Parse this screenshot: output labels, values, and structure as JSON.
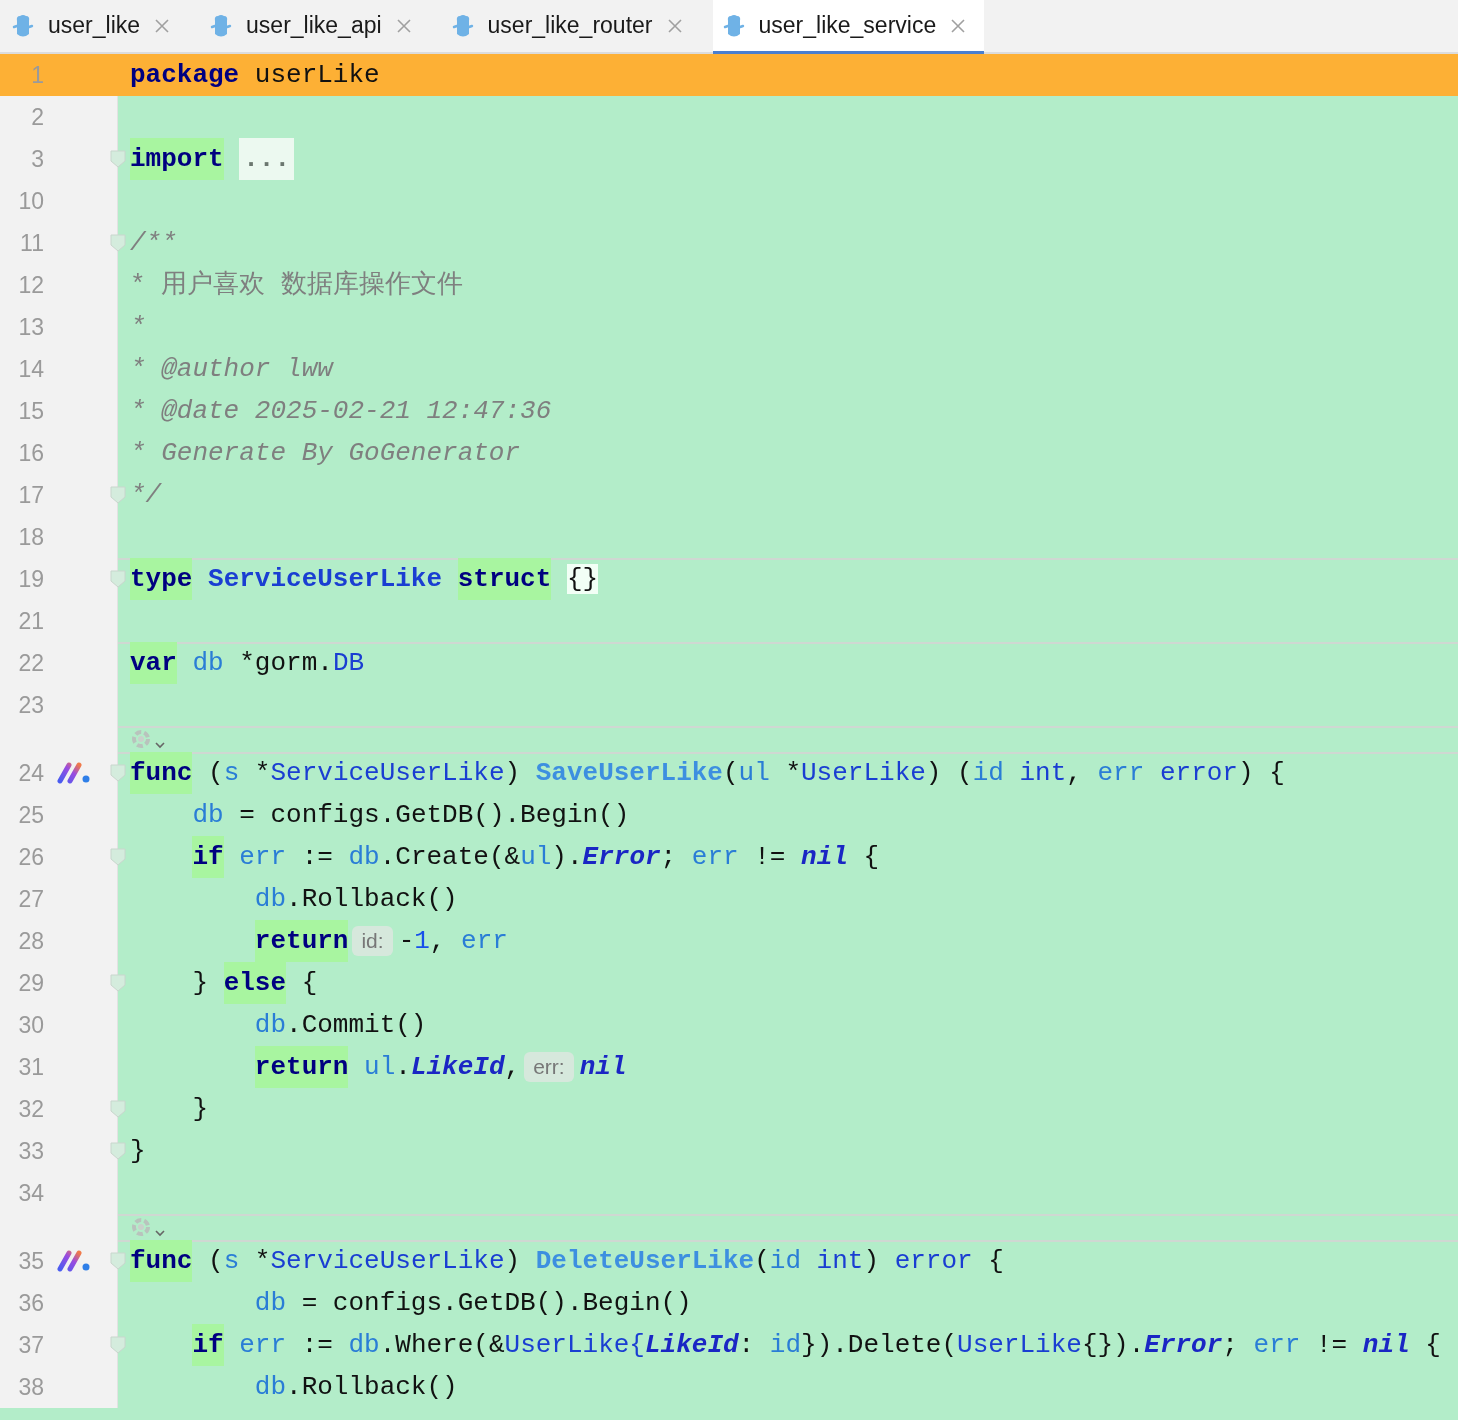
{
  "tabs": [
    {
      "label": "user_like",
      "selected": false
    },
    {
      "label": "user_like_api",
      "selected": false
    },
    {
      "label": "user_like_router",
      "selected": false
    },
    {
      "label": "user_like_service",
      "selected": true
    }
  ],
  "lines": [
    {
      "number": "1",
      "current": true,
      "fold": false,
      "implemented": false,
      "separator": false,
      "lens": false,
      "tokens": [
        {
          "kind": "kw_plain",
          "text": "package"
        },
        {
          "kind": "p",
          "text": " userLike"
        }
      ]
    },
    {
      "number": "2",
      "current": false,
      "fold": false,
      "implemented": false,
      "separator": false,
      "lens": false
    },
    {
      "number": "3",
      "current": false,
      "fold": true,
      "implemented": false,
      "separator": false,
      "lens": false,
      "tokens": [
        {
          "kind": "kw",
          "text": "import"
        },
        {
          "kind": "fold",
          "text": " ..."
        }
      ]
    },
    {
      "number": "10",
      "current": false,
      "fold": false,
      "implemented": false,
      "separator": false,
      "lens": false
    },
    {
      "number": "11",
      "current": false,
      "fold": true,
      "implemented": false,
      "separator": false,
      "lens": false,
      "tokens": [
        {
          "kind": "c",
          "text": "/**"
        }
      ]
    },
    {
      "number": "12",
      "current": false,
      "fold": false,
      "implemented": false,
      "separator": false,
      "lens": false,
      "tokens": [
        {
          "kind": "cz",
          "text": "* 用户喜欢 数据库操作文件"
        }
      ]
    },
    {
      "number": "13",
      "current": false,
      "fold": false,
      "implemented": false,
      "separator": false,
      "lens": false,
      "tokens": [
        {
          "kind": "c",
          "text": "*"
        }
      ]
    },
    {
      "number": "14",
      "current": false,
      "fold": false,
      "implemented": false,
      "separator": false,
      "lens": false,
      "tokens": [
        {
          "kind": "c",
          "text": "* @author lww"
        }
      ]
    },
    {
      "number": "15",
      "current": false,
      "fold": false,
      "implemented": false,
      "separator": false,
      "lens": false,
      "tokens": [
        {
          "kind": "c",
          "text": "* @date 2025-02-21 12:47:36"
        }
      ]
    },
    {
      "number": "16",
      "current": false,
      "fold": false,
      "implemented": false,
      "separator": false,
      "lens": false,
      "tokens": [
        {
          "kind": "c",
          "text": "* Generate By GoGenerator"
        }
      ]
    },
    {
      "number": "17",
      "current": false,
      "fold": true,
      "implemented": false,
      "separator": false,
      "lens": false,
      "tokens": [
        {
          "kind": "c",
          "text": "*/"
        }
      ]
    },
    {
      "number": "18",
      "current": false,
      "fold": false,
      "implemented": false,
      "separator": false,
      "lens": false
    },
    {
      "number": "19",
      "current": false,
      "fold": true,
      "implemented": false,
      "separator": true,
      "lens": false,
      "tokens": [
        {
          "kind": "kw",
          "text": "type"
        },
        {
          "kind": "tyd",
          "text": " ServiceUserLike"
        },
        {
          "kind": "kw",
          "text": " struct"
        },
        {
          "kind": "brace",
          "text": " {}"
        }
      ]
    },
    {
      "number": "21",
      "current": false,
      "fold": false,
      "implemented": false,
      "separator": false,
      "lens": false
    },
    {
      "number": "22",
      "current": false,
      "fold": false,
      "implemented": false,
      "separator": true,
      "lens": false,
      "tokens": [
        {
          "kind": "kw",
          "text": "var"
        },
        {
          "kind": "v",
          "text": " db"
        },
        {
          "kind": "p",
          "text": " *gorm."
        },
        {
          "kind": "ty",
          "text": "DB"
        }
      ]
    },
    {
      "number": "23",
      "current": false,
      "fold": false,
      "implemented": false,
      "separator": false,
      "lens": false
    },
    {
      "number": "24",
      "current": false,
      "fold": true,
      "implemented": true,
      "separator": true,
      "lens": true,
      "tokens": [
        {
          "kind": "kw",
          "text": "func"
        },
        {
          "kind": "p",
          "text": " ("
        },
        {
          "kind": "v",
          "text": "s"
        },
        {
          "kind": "p",
          "text": " *"
        },
        {
          "kind": "ty",
          "text": "ServiceUserLike"
        },
        {
          "kind": "p",
          "text": ") "
        },
        {
          "kind": "fn",
          "text": "SaveUserLike"
        },
        {
          "kind": "p",
          "text": "("
        },
        {
          "kind": "v",
          "text": "ul"
        },
        {
          "kind": "p",
          "text": " *"
        },
        {
          "kind": "ty",
          "text": "UserLike"
        },
        {
          "kind": "p",
          "text": ") ("
        },
        {
          "kind": "v",
          "text": "id"
        },
        {
          "kind": "ty",
          "text": " int"
        },
        {
          "kind": "p",
          "text": ", "
        },
        {
          "kind": "v",
          "text": "err"
        },
        {
          "kind": "ty",
          "text": " error"
        },
        {
          "kind": "p",
          "text": ") {"
        }
      ]
    },
    {
      "number": "25",
      "current": false,
      "fold": false,
      "implemented": false,
      "separator": false,
      "lens": false,
      "tokens": [
        {
          "kind": "v",
          "text": "    db"
        },
        {
          "kind": "p",
          "text": " = configs.GetDB().Begin()"
        }
      ]
    },
    {
      "number": "26",
      "current": false,
      "fold": true,
      "implemented": false,
      "separator": false,
      "lens": false,
      "tokens": [
        {
          "kind": "kw",
          "text": "    if"
        },
        {
          "kind": "v",
          "text": " err"
        },
        {
          "kind": "p",
          "text": " := "
        },
        {
          "kind": "v",
          "text": "db"
        },
        {
          "kind": "p",
          "text": ".Create(&"
        },
        {
          "kind": "v",
          "text": "ul"
        },
        {
          "kind": "p",
          "text": ")."
        },
        {
          "kind": "fi",
          "text": "Error"
        },
        {
          "kind": "p",
          "text": "; "
        },
        {
          "kind": "v",
          "text": "err"
        },
        {
          "kind": "p",
          "text": " != "
        },
        {
          "kind": "fi",
          "text": "nil"
        },
        {
          "kind": "p",
          "text": " {"
        }
      ]
    },
    {
      "number": "27",
      "current": false,
      "fold": false,
      "implemented": false,
      "separator": false,
      "lens": false,
      "tokens": [
        {
          "kind": "v",
          "text": "        db"
        },
        {
          "kind": "p",
          "text": ".Rollback()"
        }
      ]
    },
    {
      "number": "28",
      "current": false,
      "fold": false,
      "implemented": false,
      "separator": false,
      "lens": false,
      "tokens": [
        {
          "kind": "kw",
          "text": "        return"
        },
        {
          "kind": "hint",
          "text": "id:"
        },
        {
          "kind": "p",
          "text": "-"
        },
        {
          "kind": "num",
          "text": "1"
        },
        {
          "kind": "p",
          "text": ", "
        },
        {
          "kind": "v",
          "text": "err"
        }
      ]
    },
    {
      "number": "29",
      "current": false,
      "fold": true,
      "implemented": false,
      "separator": false,
      "lens": false,
      "tokens": [
        {
          "kind": "p",
          "text": "    } "
        },
        {
          "kind": "kw",
          "text": "else"
        },
        {
          "kind": "p",
          "text": " {"
        }
      ]
    },
    {
      "number": "30",
      "current": false,
      "fold": false,
      "implemented": false,
      "separator": false,
      "lens": false,
      "tokens": [
        {
          "kind": "v",
          "text": "        db"
        },
        {
          "kind": "p",
          "text": ".Commit()"
        }
      ]
    },
    {
      "number": "31",
      "current": false,
      "fold": false,
      "implemented": false,
      "separator": false,
      "lens": false,
      "tokens": [
        {
          "kind": "kw",
          "text": "        return"
        },
        {
          "kind": "v",
          "text": " ul"
        },
        {
          "kind": "p",
          "text": "."
        },
        {
          "kind": "fi",
          "text": "LikeId"
        },
        {
          "kind": "p",
          "text": ","
        },
        {
          "kind": "hint",
          "text": "err:"
        },
        {
          "kind": "fi",
          "text": "nil"
        }
      ]
    },
    {
      "number": "32",
      "current": false,
      "fold": true,
      "implemented": false,
      "separator": false,
      "lens": false,
      "tokens": [
        {
          "kind": "p",
          "text": "    }"
        }
      ]
    },
    {
      "number": "33",
      "current": false,
      "fold": true,
      "implemented": false,
      "separator": false,
      "lens": false,
      "tokens": [
        {
          "kind": "p",
          "text": "}"
        }
      ]
    },
    {
      "number": "34",
      "current": false,
      "fold": false,
      "implemented": false,
      "separator": false,
      "lens": false
    },
    {
      "number": "35",
      "current": false,
      "fold": true,
      "implemented": true,
      "separator": true,
      "lens": true,
      "tokens": [
        {
          "kind": "kw",
          "text": "func"
        },
        {
          "kind": "p",
          "text": " ("
        },
        {
          "kind": "v",
          "text": "s"
        },
        {
          "kind": "p",
          "text": " *"
        },
        {
          "kind": "ty",
          "text": "ServiceUserLike"
        },
        {
          "kind": "p",
          "text": ") "
        },
        {
          "kind": "fn",
          "text": "DeleteUserLike"
        },
        {
          "kind": "p",
          "text": "("
        },
        {
          "kind": "v",
          "text": "id"
        },
        {
          "kind": "ty",
          "text": " int"
        },
        {
          "kind": "p",
          "text": ") "
        },
        {
          "kind": "ty",
          "text": "error"
        },
        {
          "kind": "p",
          "text": " {"
        }
      ]
    },
    {
      "number": "36",
      "current": false,
      "fold": false,
      "implemented": false,
      "separator": false,
      "lens": false,
      "tokens": [
        {
          "kind": "v",
          "text": "        db"
        },
        {
          "kind": "p",
          "text": " = configs.GetDB().Begin()"
        }
      ]
    },
    {
      "number": "37",
      "current": false,
      "fold": true,
      "implemented": false,
      "separator": false,
      "lens": false,
      "tokens": [
        {
          "kind": "kw",
          "text": "    if"
        },
        {
          "kind": "v",
          "text": " err"
        },
        {
          "kind": "p",
          "text": " := "
        },
        {
          "kind": "v",
          "text": "db"
        },
        {
          "kind": "p",
          "text": ".Where(&"
        },
        {
          "kind": "ty",
          "text": "UserLike{"
        },
        {
          "kind": "fi",
          "text": "LikeId"
        },
        {
          "kind": "p",
          "text": ": "
        },
        {
          "kind": "v",
          "text": "id"
        },
        {
          "kind": "p",
          "text": "}).Delete("
        },
        {
          "kind": "ty",
          "text": "UserLike"
        },
        {
          "kind": "p",
          "text": "{})."
        },
        {
          "kind": "fi",
          "text": "Error"
        },
        {
          "kind": "p",
          "text": "; "
        },
        {
          "kind": "v",
          "text": "err"
        },
        {
          "kind": "p",
          "text": " != "
        },
        {
          "kind": "fi",
          "text": "nil"
        },
        {
          "kind": "p",
          "text": " {"
        }
      ]
    },
    {
      "number": "38",
      "current": false,
      "fold": false,
      "implemented": false,
      "separator": false,
      "lens": false,
      "tokens": [
        {
          "kind": "v",
          "text": "        db"
        },
        {
          "kind": "p",
          "text": ".Rollback()"
        }
      ]
    }
  ]
}
